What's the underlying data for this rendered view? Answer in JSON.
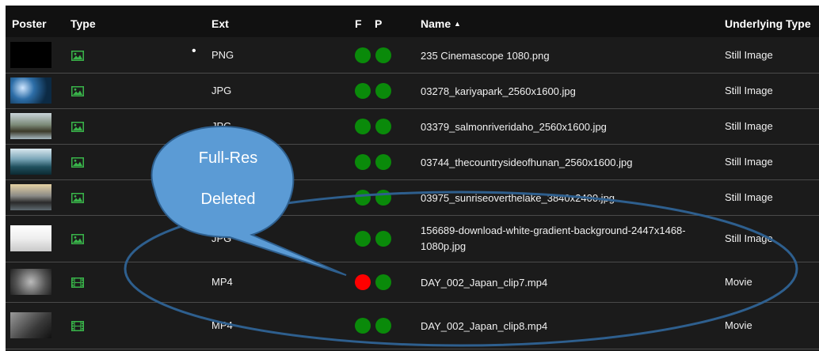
{
  "header": {
    "poster": "Poster",
    "type": "Type",
    "ext": "Ext",
    "f": "F",
    "p": "P",
    "name": "Name",
    "sort_indicator": "▲",
    "underlying": "Underlying Type"
  },
  "rows": [
    {
      "ext": "PNG",
      "name": "235 Cinemascope 1080.png",
      "underlying": "Still Image",
      "type_icon": "image-icon",
      "f_status": "green",
      "p_status": "green",
      "selected": true
    },
    {
      "ext": "JPG",
      "name": "03278_kariyapark_2560x1600.jpg",
      "underlying": "Still Image",
      "type_icon": "image-icon",
      "f_status": "green",
      "p_status": "green"
    },
    {
      "ext": "JPG",
      "name": "03379_salmonriveridaho_2560x1600.jpg",
      "underlying": "Still Image",
      "type_icon": "image-icon",
      "f_status": "green",
      "p_status": "green"
    },
    {
      "ext": "JPG",
      "name": "03744_thecountrysideofhunan_2560x1600.jpg",
      "underlying": "Still Image",
      "type_icon": "image-icon",
      "f_status": "green",
      "p_status": "green"
    },
    {
      "ext": "JPG",
      "name": "03975_sunriseoverthelake_3840x2400.jpg",
      "underlying": "Still Image",
      "type_icon": "image-icon",
      "f_status": "green",
      "p_status": "green"
    },
    {
      "ext": "JPG",
      "name": "156689-download-white-gradient-background-2447x1468-1080p.jpg",
      "underlying": "Still Image",
      "type_icon": "image-icon",
      "f_status": "green",
      "p_status": "green"
    },
    {
      "ext": "MP4",
      "name": "DAY_002_Japan_clip7.mp4",
      "underlying": "Movie",
      "type_icon": "film-icon",
      "f_status": "red",
      "p_status": "green"
    },
    {
      "ext": "MP4",
      "name": "DAY_002_Japan_clip8.mp4",
      "underlying": "Movie",
      "type_icon": "film-icon",
      "f_status": "green",
      "p_status": "green"
    }
  ],
  "callout": {
    "line1": "Full-Res",
    "line2": "Deleted"
  },
  "colors": {
    "green": "#0a8a0a",
    "red": "#ff0000",
    "icon_green": "#39b54a",
    "callout_fill": "#5b9bd5",
    "callout_stroke": "#2e5f8e"
  }
}
